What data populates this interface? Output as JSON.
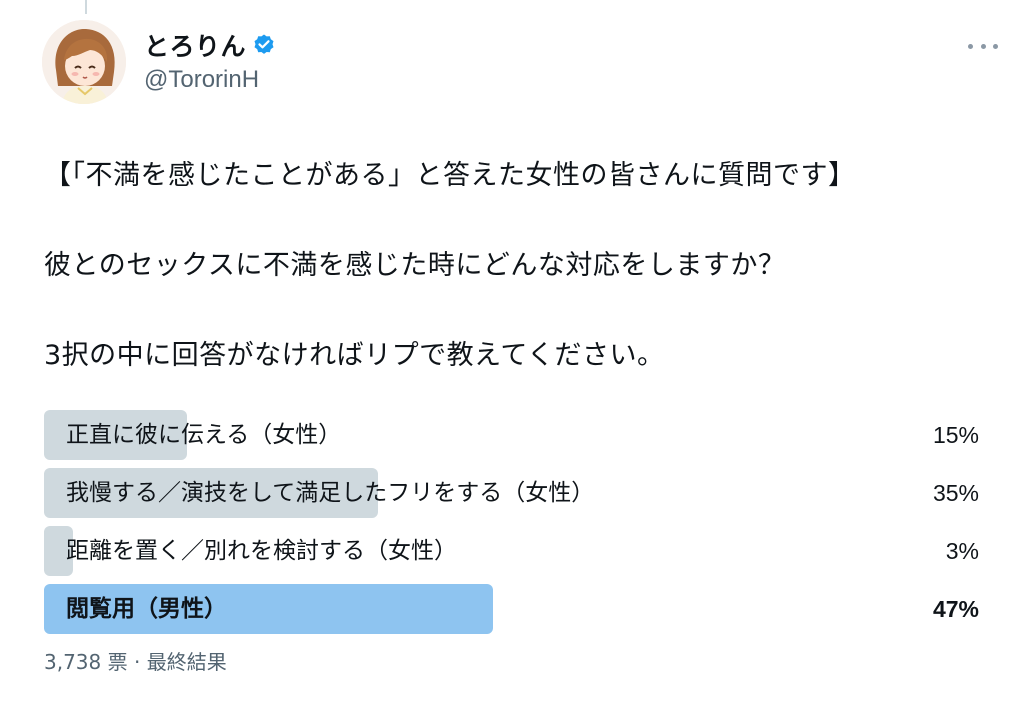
{
  "user": {
    "display_name": "とろりん",
    "handle": "@TororinH",
    "verified": true
  },
  "tweet": {
    "lines": [
      "【「不満を感じたことがある」と答えた女性の皆さんに質問です】",
      "彼とのセックスに不満を感じた時にどんな対応をしますか？",
      "3択の中に回答がなければリプで教えてください。"
    ]
  },
  "poll": {
    "options": [
      {
        "label": "正直に彼に伝える（女性）",
        "percent_text": "15%",
        "percent": 15,
        "winner": false
      },
      {
        "label": "我慢する／演技をして満足したフリをする（女性）",
        "percent_text": "35%",
        "percent": 35,
        "winner": false
      },
      {
        "label": "距離を置く／別れを検討する（女性）",
        "percent_text": "3%",
        "percent": 3,
        "winner": false
      },
      {
        "label": "閲覧用（男性）",
        "percent_text": "47%",
        "percent": 47,
        "winner": true
      }
    ],
    "votes": "3,738 票",
    "separator": "·",
    "status": "最終結果"
  },
  "colors": {
    "bar_default": "#cfd9de",
    "bar_winner": "#8ec4f0",
    "verified_badge": "#1d9bf0",
    "secondary_text": "#536471"
  },
  "icons": {
    "verified": "verified-badge-icon",
    "more": "more-horizontal-icon"
  }
}
